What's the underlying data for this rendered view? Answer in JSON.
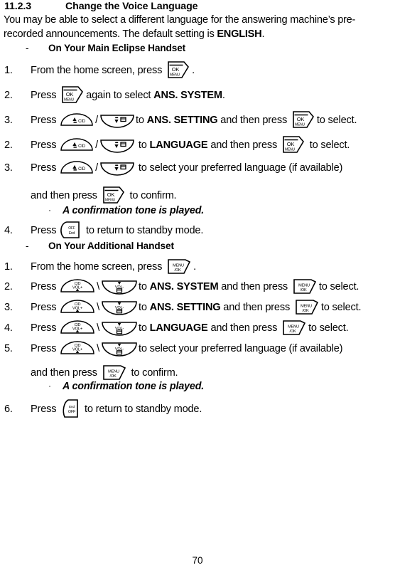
{
  "document": {
    "section_number": "11.2.3",
    "section_title": "Change the Voice Language",
    "intro_part1": "You may be able to select a different language for the answering machine’s pre- recorded announcements. The default setting is ",
    "intro_bold": "ENGLISH",
    "intro_end": ".",
    "page_number": "70"
  },
  "main_handset": {
    "dash": "-",
    "heading": "On Your Main Eclipse Handset",
    "steps": [
      {
        "index": "1.",
        "before": "From the home screen, press",
        "key": "ok-menu-key",
        "after": "."
      },
      {
        "index": "2.",
        "before": "Press",
        "key": "ok-menu-key",
        "mid": "again to select",
        "bold": "ANS. SYSTEM",
        "after": "."
      },
      {
        "index": "3.",
        "before": "Press",
        "key_up": "cid-up-key",
        "separator": "/",
        "key_down": "down-key",
        "mid": "to",
        "bold": "ANS. SETTING",
        "mid2": "and then press",
        "key_confirm": "ok-menu-key",
        "after": "to select."
      },
      {
        "index": "2.",
        "before": "Press",
        "key_up": "cid-up-key",
        "separator": "/",
        "key_down": "down-key",
        "mid": "to",
        "bold": "LANGUAGE",
        "mid2": "and then press",
        "key_confirm": "ok-menu-key",
        "after": "to select."
      },
      {
        "index": "3.",
        "before": "Press",
        "key_up": "cid-up-key",
        "separator": "/",
        "key_down": "down-key",
        "after": "to select your preferred language (if available)",
        "continuation_before": "and then press",
        "continuation_key": "ok-menu-key",
        "continuation_after": "to confirm."
      }
    ],
    "bullet": {
      "marker": "·",
      "text": "A confirmation tone is played."
    },
    "final_step": {
      "index": "4.",
      "before": "Press",
      "key": "off-end-key",
      "after": "to return to standby mode."
    }
  },
  "additional_handset": {
    "dash": "-",
    "heading": "On Your Additional Handset",
    "steps": [
      {
        "index": "1.",
        "before": "From the home screen, press",
        "key": "menu-ok-key",
        "after": "."
      },
      {
        "index": "2.",
        "before": "Press",
        "key_up": "cid-volup-key",
        "separator": "\\",
        "key_down": "voldown-key",
        "mid": "to",
        "bold": "ANS. SYSTEM",
        "mid2": "and then press",
        "key_confirm": "menu-ok-key",
        "after": "to select."
      },
      {
        "index": "3.",
        "before": "Press",
        "key_up": "cid-volup-key",
        "separator": "\\",
        "key_down": "voldown-key",
        "mid": "to",
        "bold": "ANS. SETTING",
        "mid2": "and then press",
        "key_confirm": "menu-ok-key",
        "after": "to select."
      },
      {
        "index": "4.",
        "before": "Press",
        "key_up": "cid-volup-key",
        "separator": "\\",
        "key_down": "voldown-key",
        "mid": "to",
        "bold": "LANGUAGE",
        "mid2": "and then press",
        "key_confirm": "menu-ok-key",
        "after": "to select."
      },
      {
        "index": "5.",
        "before": "Press",
        "key_up": "cid-volup-key",
        "separator": "\\",
        "key_down": "voldown-key",
        "after": "to select your preferred language (if available)",
        "continuation_before": "and then press",
        "continuation_key": "menu-ok-key",
        "continuation_after": "to confirm."
      }
    ],
    "bullet": {
      "marker": "·",
      "text": "A confirmation tone is played."
    },
    "final_step": {
      "index": "6.",
      "before": "Press",
      "key": "end-off-key",
      "after": "to return to standby mode."
    }
  },
  "key_labels": {
    "ok": "OK",
    "menu": "MENU",
    "menu_ok_top": "MENU",
    "menu_ok_bottom": "/OK",
    "off": "OFF",
    "end": "End",
    "cid": "CID",
    "vol_plus": "VOL+",
    "vol_minus": "VOL-"
  },
  "colors": {
    "ink": "#000000",
    "paper": "#ffffff"
  }
}
